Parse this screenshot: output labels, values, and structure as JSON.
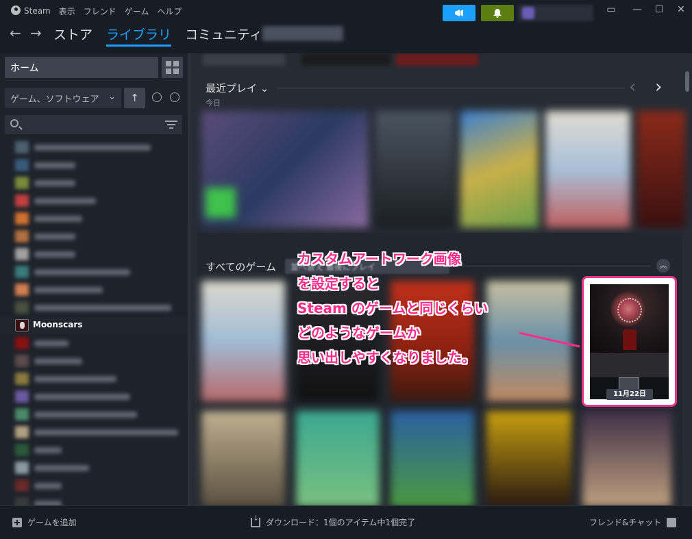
{
  "titlebar": {
    "menu": [
      "Steam",
      "表示",
      "フレンド",
      "ゲーム",
      "ヘルプ"
    ],
    "news_icon": "megaphone-icon",
    "notif_icon": "bell-icon",
    "window_controls": [
      "monitor-icon",
      "minimize-icon",
      "maximize-icon",
      "close-icon"
    ]
  },
  "nav": {
    "back": "←",
    "forward": "→",
    "links": [
      "ストア",
      "ライブラリ",
      "コミュニティ"
    ],
    "active_index": 1
  },
  "sidebar": {
    "home_label": "ホーム",
    "filter_label": "ゲーム、ソフトウェア",
    "filter_chevron": "⌄",
    "sort_icon": "↑",
    "selected_game": "Moonscars"
  },
  "main": {
    "recent_title": "最近プレイ",
    "recent_chevron": "⌄",
    "recent_sub": "今日",
    "prev_arrow": "‹",
    "next_arrow": "›",
    "all_games_title": "すべてのゲーム",
    "sort_chip": "並べ替え   最後にプレイ",
    "collapse": "︽"
  },
  "annotation": {
    "lines": [
      "カスタムアートワーク画像",
      "を設定すると",
      "Steam のゲームと同じくらい",
      "どのようなゲームか",
      "思い出しやすくなりました。"
    ],
    "date_badge": "11月22日",
    "color": "#e8348a"
  },
  "bottombar": {
    "add_game": "ゲームを追加",
    "download": "ダウンロード：1個のアイテム中1個完了",
    "friends": "フレンド&チャット"
  },
  "colors": {
    "accent": "#1a9fff",
    "notif": "#5c7e10",
    "background": "#171d25"
  }
}
